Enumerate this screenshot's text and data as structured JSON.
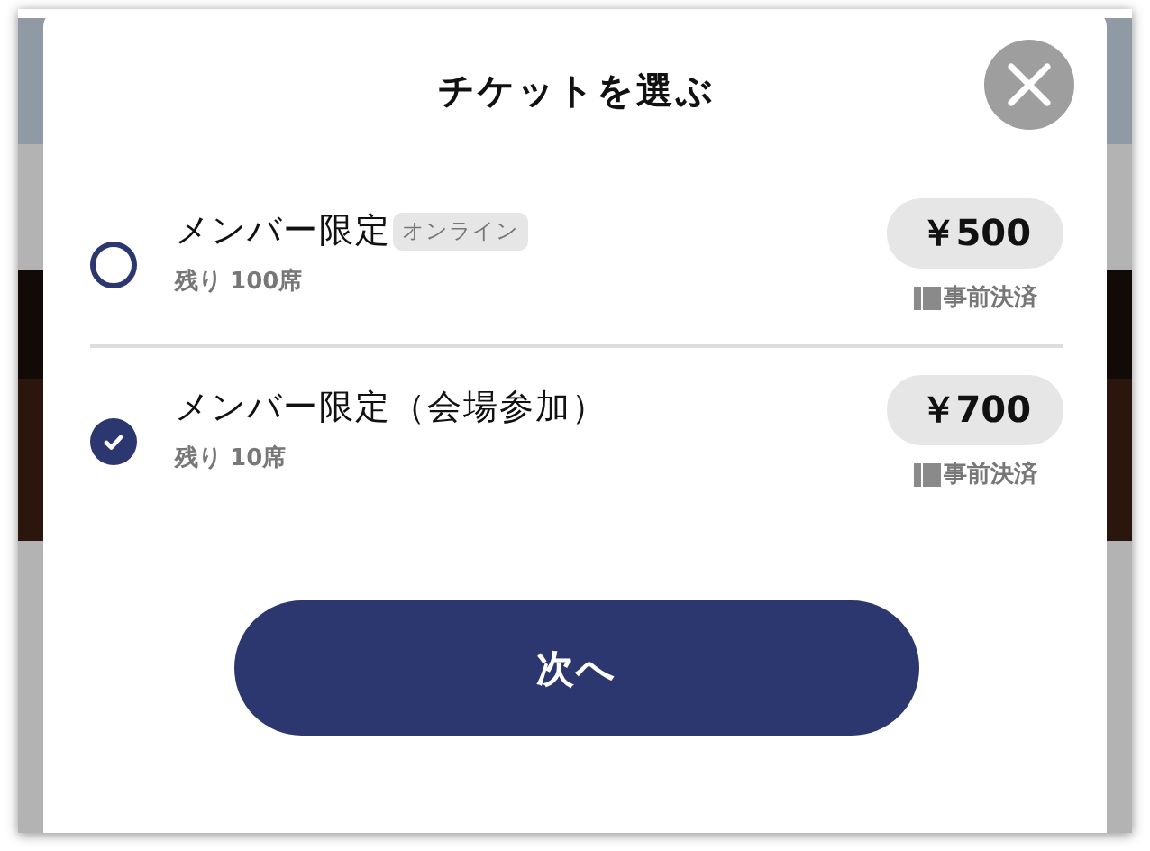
{
  "title": "チケットを選ぶ",
  "tickets": [
    {
      "name": "メンバー限定",
      "tag": "オンライン",
      "remaining": "残り 100席",
      "price": "￥500",
      "payment": "事前決済",
      "selected": false
    },
    {
      "name": "メンバー限定（会場参加）",
      "remaining": "残り 10席",
      "price": "￥700",
      "payment": "事前決済",
      "selected": true
    }
  ],
  "next_button": {
    "label": "次へ"
  }
}
